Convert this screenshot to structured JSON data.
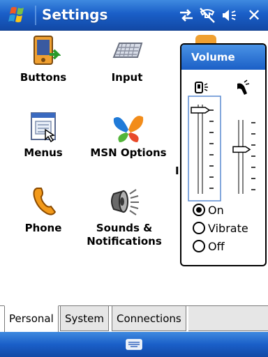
{
  "titlebar": {
    "title": "Settings",
    "close_label": "✕"
  },
  "apps": [
    {
      "label": "Buttons"
    },
    {
      "label": "Input"
    },
    {
      "label": "Menus"
    },
    {
      "label": "MSN Options"
    },
    {
      "label": "Phone"
    },
    {
      "label": "Sounds & Notifications"
    }
  ],
  "tabs": [
    {
      "label": "Personal"
    },
    {
      "label": "System"
    },
    {
      "label": "Connections"
    }
  ],
  "volume": {
    "title": "Volume",
    "system_level": 1.0,
    "ringer_level": 0.6,
    "options": [
      "On",
      "Vibrate",
      "Off"
    ],
    "selected": "On",
    "cut_text": "I"
  },
  "colors": {
    "bar_blue": "#1a5fc8",
    "accent": "#2f7be0"
  }
}
